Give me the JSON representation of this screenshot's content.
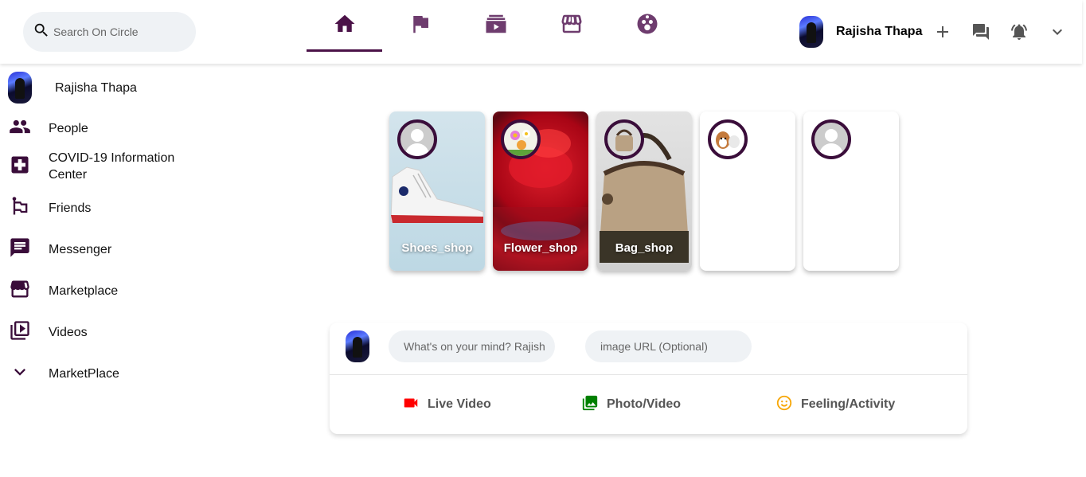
{
  "header": {
    "search": {
      "placeholder": "Search On Circle"
    },
    "nav": [
      {
        "name": "home",
        "icon": "home-icon",
        "active": true
      },
      {
        "name": "pages",
        "icon": "flag-icon",
        "active": false
      },
      {
        "name": "watch",
        "icon": "video-library-icon",
        "active": false
      },
      {
        "name": "marketplace",
        "icon": "store-icon",
        "active": false
      },
      {
        "name": "groups",
        "icon": "group-icon",
        "active": false
      }
    ],
    "user_name": "Rajisha Thapa"
  },
  "sidebar": {
    "user_name": "Rajisha Thapa",
    "items": [
      {
        "label": "People",
        "icon": "people-icon"
      },
      {
        "label": "COVID-19 Information Center",
        "icon": "medical-cross-icon"
      },
      {
        "label": "Friends",
        "icon": "emoji-flags-icon"
      },
      {
        "label": "Messenger",
        "icon": "chat-icon"
      },
      {
        "label": "Marketplace",
        "icon": "storefront-icon"
      },
      {
        "label": "Videos",
        "icon": "video-library-icon"
      },
      {
        "label": "MarketPlace",
        "icon": "expand-more-icon"
      }
    ]
  },
  "stories": [
    {
      "label": "Shoes_shop",
      "image": "sneaker"
    },
    {
      "label": "Flower_shop",
      "image": "red-flower"
    },
    {
      "label": "Bag_shop",
      "image": "handbag"
    },
    {
      "label": "",
      "image": "blank"
    },
    {
      "label": "",
      "image": "blank"
    }
  ],
  "post": {
    "message_placeholder": "What's on your mind? Rajish",
    "image_placeholder": "image URL (Optional)",
    "actions": [
      {
        "label": "Live Video",
        "icon": "videocam-icon",
        "color": "#ff0000"
      },
      {
        "label": "Photo/Video",
        "icon": "photo-library-icon",
        "color": "#008000"
      },
      {
        "label": "Feeling/Activity",
        "icon": "emoji-smile-icon",
        "color": "#f7a707"
      }
    ]
  },
  "colors": {
    "accent": "#4b1248",
    "nav_icon": "#6e3c6e",
    "search_bg": "#eff2f5"
  }
}
